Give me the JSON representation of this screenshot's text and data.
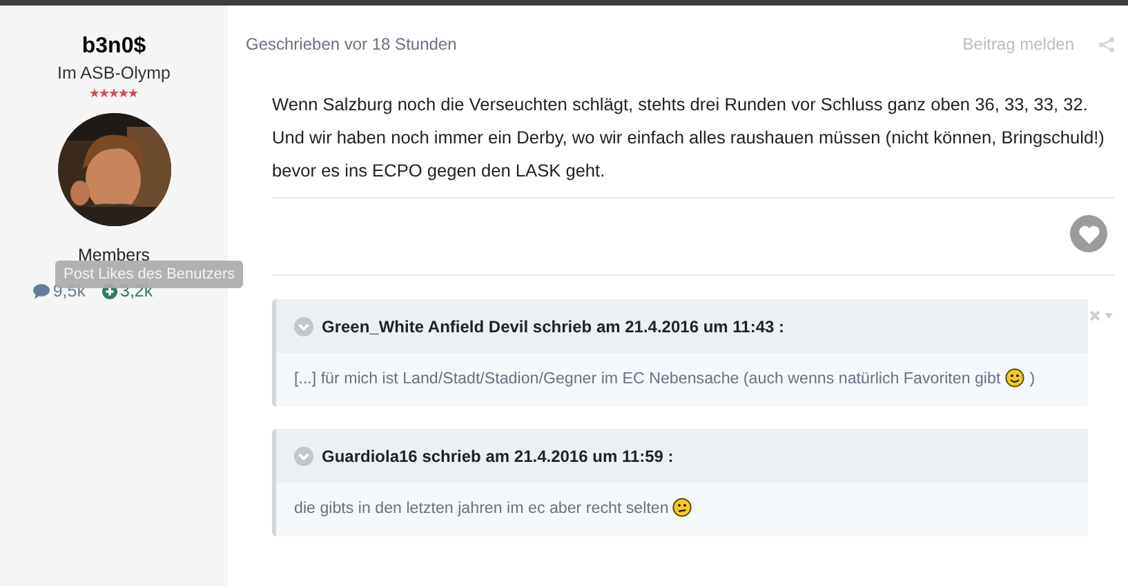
{
  "author": {
    "name": "b3n0$",
    "rank": "Im ASB-Olymp",
    "stars": 5,
    "group": "Members",
    "tooltip": "Post Likes des Benutzers",
    "posts": "9,5k",
    "likes": "3,2k"
  },
  "post": {
    "meta": "Geschrieben vor 18 Stunden",
    "report": "Beitrag melden",
    "body": "Wenn Salzburg noch die Verseuchten schlägt, stehts drei Runden vor Schluss ganz oben 36, 33, 33, 32. Und wir haben noch immer ein Derby, wo wir einfach alles raushauen müssen (nicht können, Bringschuld!) bevor es ins ECPO gegen den LASK geht.",
    "liked": false,
    "quotes": [
      {
        "header": "Green_White Anfield Devil schrieb am 21.4.2016 um 11:43 :",
        "text": "[...] für mich ist Land/Stadt/Stadion/Gegner im EC Nebensache (auch wenns natürlich Favoriten gibt",
        "kind": "smile",
        "after": ")"
      },
      {
        "header": "Guardiola16 schrieb am 21.4.2016 um 11:59 :",
        "text": "die gibts in den letzten jahren im ec aber recht selten",
        "kind": "unsure"
      }
    ]
  }
}
